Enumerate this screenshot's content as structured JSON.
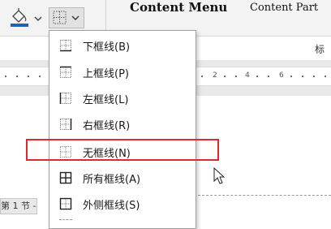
{
  "ribbon": {
    "fill_icon": "paint-bucket-icon",
    "border_icon": "borders-grid-icon",
    "dropdown_icon": "chevron-down-icon",
    "heading_big": "Content Menu",
    "heading_small": "Content Part",
    "glyph": "标"
  },
  "ruler": {
    "numbers": [
      "2",
      "4",
      "6"
    ]
  },
  "status": {
    "section_label": "第 1 节 -"
  },
  "menu": {
    "items": [
      {
        "label": "下框线(B)",
        "icon": "bottom-border-icon"
      },
      {
        "label": "上框线(P)",
        "icon": "top-border-icon"
      },
      {
        "label": "左框线(L)",
        "icon": "left-border-icon"
      },
      {
        "label": "右框线(R)",
        "icon": "right-border-icon"
      },
      {
        "label": "无框线(N)",
        "icon": "no-border-icon"
      },
      {
        "label": "所有框线(A)",
        "icon": "all-borders-icon"
      },
      {
        "label": "外侧框线(S)",
        "icon": "outside-borders-icon"
      }
    ]
  },
  "colors": {
    "highlight": "#e0282e",
    "fill_blue": "#1f5fbf"
  }
}
